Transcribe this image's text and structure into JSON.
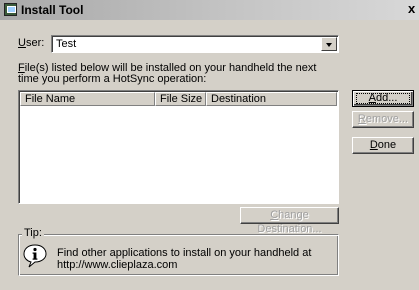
{
  "window": {
    "title": "Install Tool",
    "close_glyph": "x"
  },
  "user": {
    "label_underline": "U",
    "label_rest": "ser:",
    "value": "Test"
  },
  "description": {
    "line1_underline": "F",
    "line1_rest": "ile(s) listed below will be installed on your handheld the next",
    "line2": "time you perform a HotSync operation:"
  },
  "file_list": {
    "columns": [
      "File Name",
      "File Size",
      "Destination"
    ],
    "rows": []
  },
  "buttons": {
    "add": {
      "underline": "A",
      "rest": "dd..."
    },
    "remove": {
      "underline": "R",
      "rest": "emove..."
    },
    "done": {
      "underline": "D",
      "rest": "one"
    },
    "change_destination": {
      "underline": "C",
      "rest": "hange Destination..."
    }
  },
  "tip": {
    "label": "Tip:",
    "line1": "Find other applications to install on your handheld at",
    "line2": "http://www.clieplaza.com"
  },
  "icons": {
    "window": "install-tool-icon",
    "info": "info-icon",
    "dropdown": "chevron-down-icon"
  }
}
